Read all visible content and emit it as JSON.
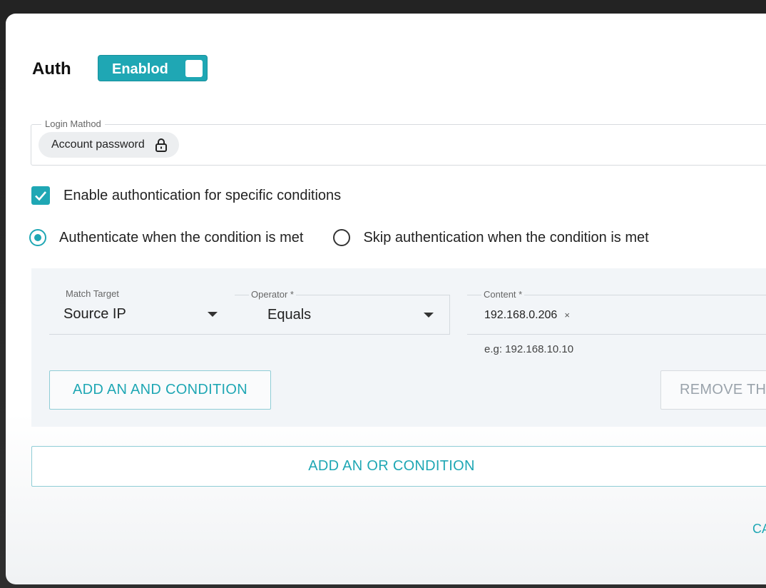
{
  "auth": {
    "label": "Auth",
    "toggle_label": "Enablod"
  },
  "login_method": {
    "legend": "Login Mathod",
    "chip_label": "Account password",
    "chip_icon": "lock-icon"
  },
  "enable_conditions": {
    "label": "Enable authontication for specific conditions",
    "checked": true
  },
  "mode": {
    "option_authenticate": "Authenticate when the condition is met",
    "option_skip": "Skip authentication when the condition is met",
    "selected": "authenticate"
  },
  "condition": {
    "match_target_label": "Match Target",
    "match_target_value": "Source IP",
    "operator_label": "Operator *",
    "operator_value": "Equals",
    "content_label": "Content *",
    "content_chip": "192.168.0.206",
    "content_chip_remove": "×",
    "content_hint": "e.g: 192.168.10.10"
  },
  "buttons": {
    "add_and": "ADD AN AND CONDITION",
    "remove": "REMOVE THIS",
    "add_or": "ADD AN OR CONDITION",
    "cancel": "CANCEL"
  },
  "colors": {
    "accent": "#1fa7b4",
    "panel": "#f2f5f8"
  }
}
